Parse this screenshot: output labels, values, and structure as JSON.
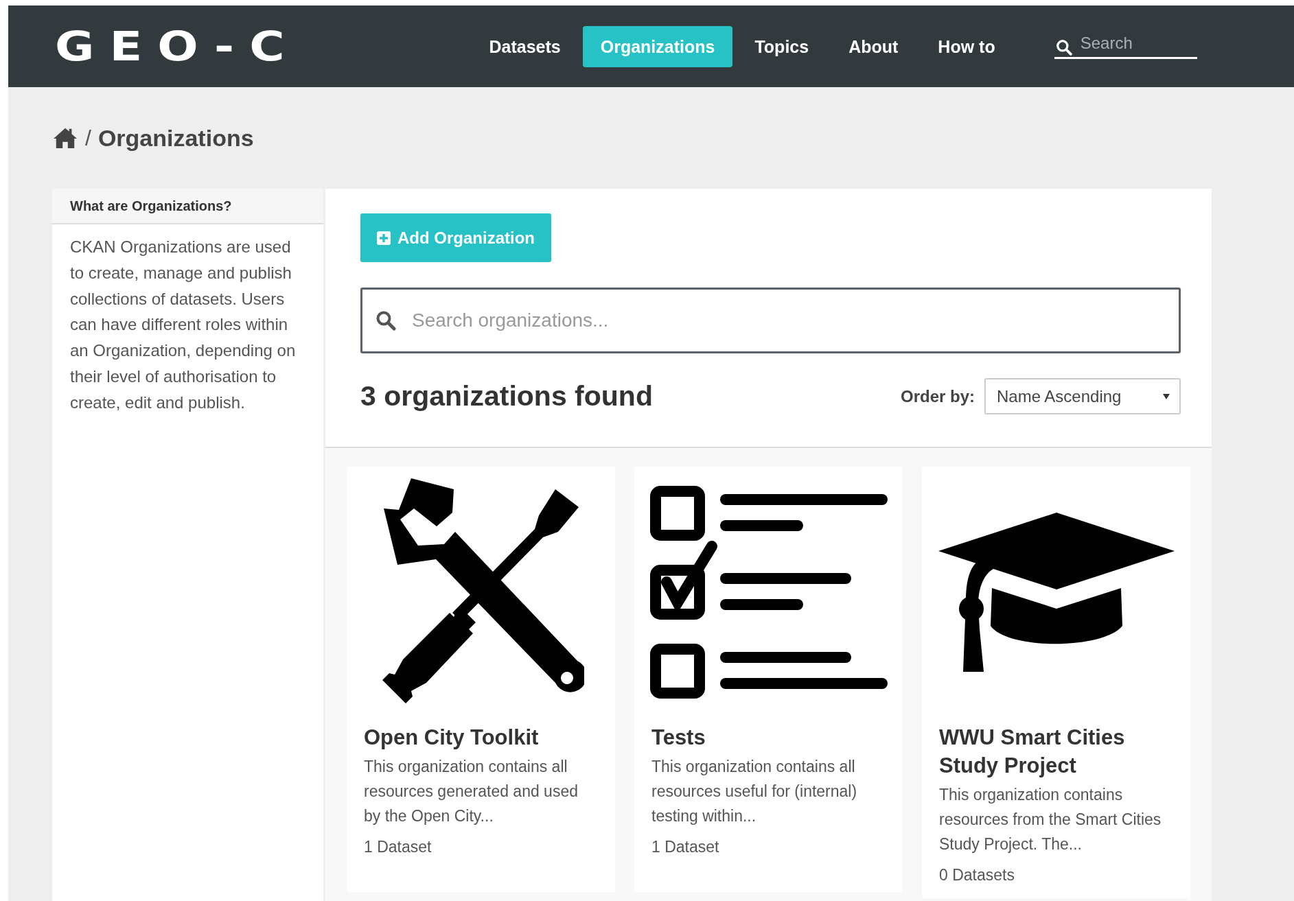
{
  "header": {
    "logo": "GEO-C",
    "nav": [
      {
        "label": "Datasets",
        "selected": false
      },
      {
        "label": "Organizations",
        "selected": true
      },
      {
        "label": "Topics",
        "selected": false
      },
      {
        "label": "About",
        "selected": false
      },
      {
        "label": "How to",
        "selected": false
      }
    ],
    "search": {
      "placeholder": "Search"
    }
  },
  "breadcrumb": {
    "separator": "/",
    "current": "Organizations"
  },
  "sidebar": {
    "title": "What are Organizations?",
    "text": "CKAN Organizations are used to create, manage and publish collections of datasets. Users can have different roles within an Organization, depending on their level of authorisation to create, edit and publish."
  },
  "main": {
    "add_button": "Add Organization",
    "search": {
      "placeholder": "Search organizations..."
    },
    "results": "3 organizations found",
    "order_by": {
      "label": "Order by:",
      "value": "Name Ascending"
    }
  },
  "organizations": [
    {
      "kind": "tools",
      "name": "Open City Toolkit",
      "description": "This organization contains all resources generated and used by the Open City...",
      "count": "1 Dataset"
    },
    {
      "kind": "checklist",
      "name": "Tests",
      "description": "This organization contains all resources useful for (internal) testing within...",
      "count": "1 Dataset"
    },
    {
      "kind": "graduation-cap",
      "name": "WWU Smart Cities Study Project",
      "description": "This organization contains resources from the Smart Cities Study Project. The...",
      "count": "0 Datasets"
    }
  ]
}
